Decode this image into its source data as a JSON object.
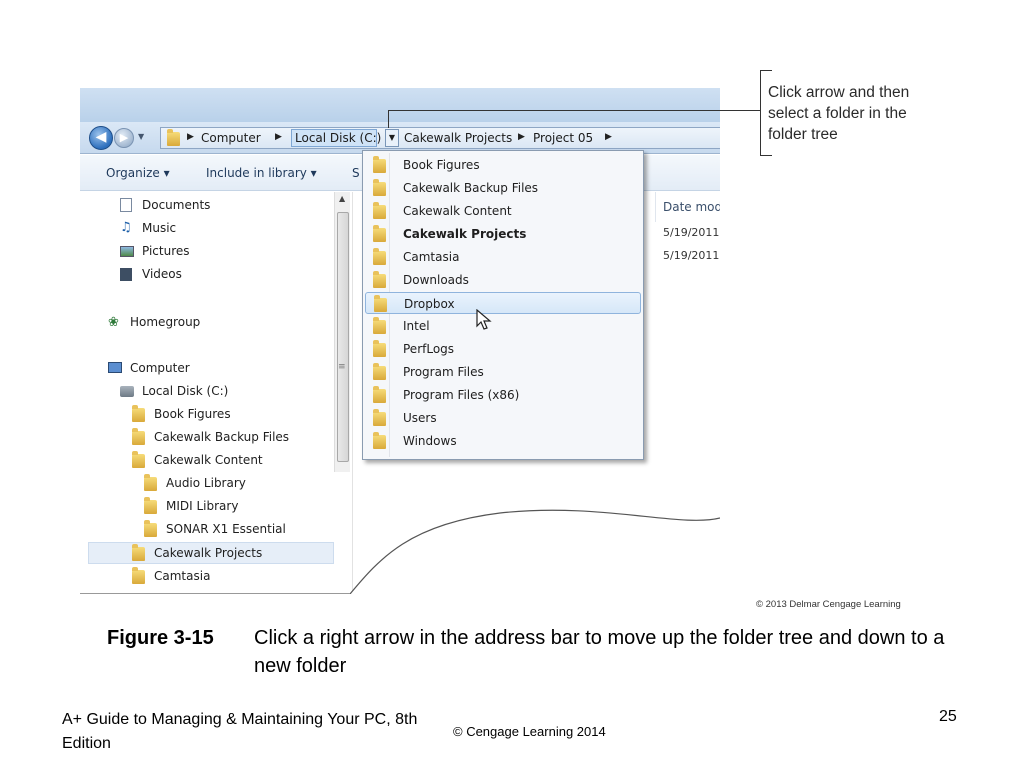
{
  "figure": {
    "address_bar": {
      "crumbs": [
        "Computer",
        "Local Disk (C:)",
        "Cakewalk Projects",
        "Project 05"
      ],
      "nav_back": "back-arrow-icon",
      "nav_forward": "forward-arrow-icon"
    },
    "toolbar": {
      "organize": "Organize ▾",
      "include": "Include in library ▾",
      "share": "S"
    },
    "nav_pane": {
      "items": [
        "Documents",
        "Music",
        "Pictures",
        "Videos",
        "Homegroup",
        "Computer",
        "Local Disk (C:)",
        "Book Figures",
        "Cakewalk Backup Files",
        "Cakewalk Content",
        "Audio Library",
        "MIDI Library",
        "SONAR X1 Essential",
        "Cakewalk Projects",
        "Camtasia"
      ],
      "selected": "Cakewalk Projects"
    },
    "content_pane": {
      "column_header": "Date mod",
      "dates": [
        "5/19/2011",
        "5/19/2011"
      ]
    },
    "folder_menu": {
      "items": [
        "Book Figures",
        "Cakewalk Backup Files",
        "Cakewalk Content",
        "Cakewalk Projects",
        "Camtasia",
        "Downloads",
        "Dropbox",
        "Intel",
        "PerfLogs",
        "Program Files",
        "Program Files (x86)",
        "Users",
        "Windows"
      ],
      "current": "Cakewalk Projects",
      "hovered": "Dropbox"
    }
  },
  "callout": "Click arrow and then select a folder in the folder tree",
  "credit": "© 2013 Delmar Cengage Learning",
  "caption": {
    "label": "Figure 3-15",
    "text": "Click a right arrow in the address bar to move up the folder tree and down to a new folder"
  },
  "footer": {
    "book_title": "A+ Guide to Managing & Maintaining Your PC, 8th Edition",
    "copyright": "© Cengage Learning  2014",
    "page_number": "25"
  },
  "colors": {
    "folder": "#e2b547",
    "selection": "#d6e7f8",
    "address_bar": "#c6d9ee"
  }
}
